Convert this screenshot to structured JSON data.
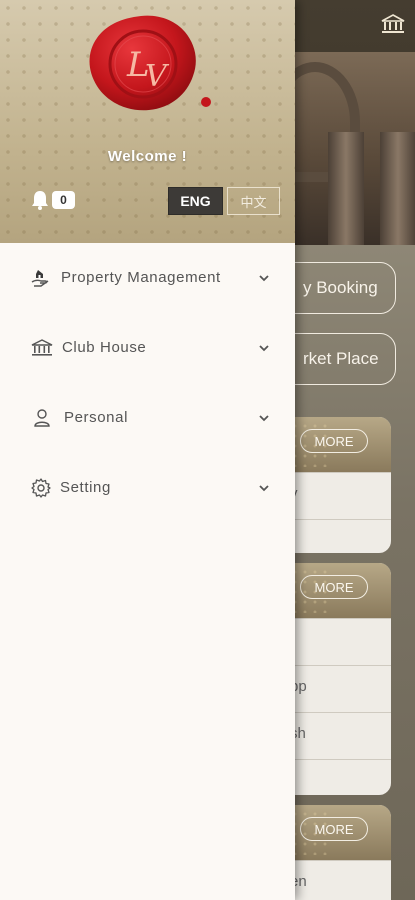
{
  "background": {
    "top_right_icon": "institution-icon",
    "buttons": [
      {
        "label": "y Booking"
      },
      {
        "label": "rket Place"
      }
    ],
    "cards": [
      {
        "more_label": "MORE",
        "rows": [
          "y",
          ""
        ]
      },
      {
        "more_label": "MORE",
        "rows": [
          "",
          "pp",
          "sh",
          ""
        ]
      },
      {
        "more_label": "MORE",
        "rows": [
          "en"
        ]
      }
    ]
  },
  "drawer": {
    "logo_text": "LV",
    "welcome": "Welcome !",
    "notification_icon": "bell-icon",
    "notification_count": "0",
    "languages": {
      "english": "ENG",
      "chinese": "中文",
      "selected": "ENG"
    },
    "menu": [
      {
        "label": "Property Management",
        "icon": "property-hand-icon"
      },
      {
        "label": "Club House",
        "icon": "clubhouse-icon"
      },
      {
        "label": "Personal",
        "icon": "person-icon"
      },
      {
        "label": "Setting",
        "icon": "gear-icon"
      }
    ]
  },
  "colors": {
    "drawer_bg": "#fcf9f5",
    "header_gold": "#c3b593",
    "seal_red": "#c4161c",
    "lang_selected_bg": "#3d3a37"
  }
}
